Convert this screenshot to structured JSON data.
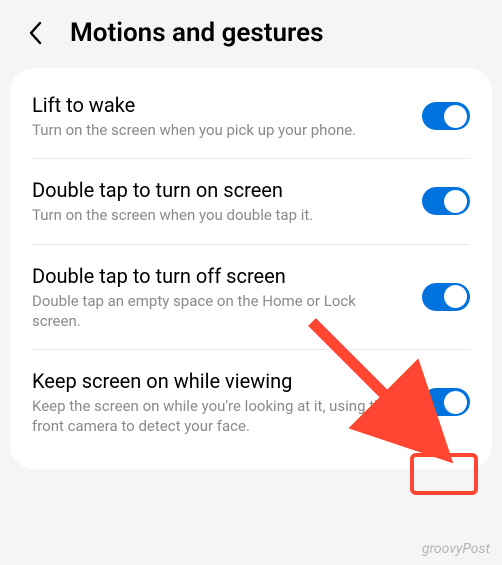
{
  "header": {
    "title": "Motions and gestures"
  },
  "settings": [
    {
      "title": "Lift to wake",
      "desc": "Turn on the screen when you pick up your phone.",
      "enabled": true
    },
    {
      "title": "Double tap to turn on screen",
      "desc": "Turn on the screen when you double tap it.",
      "enabled": true
    },
    {
      "title": "Double tap to turn off screen",
      "desc": "Double tap an empty space on the Home or Lock screen.",
      "enabled": true
    },
    {
      "title": "Keep screen on while viewing",
      "desc": "Keep the screen on while you're looking at it, using the front camera to detect your face.",
      "enabled": true
    }
  ],
  "watermark": "groovyPost",
  "annotation": {
    "highlight_target": "keep-screen-toggle",
    "arrow_color": "#ff4633"
  }
}
